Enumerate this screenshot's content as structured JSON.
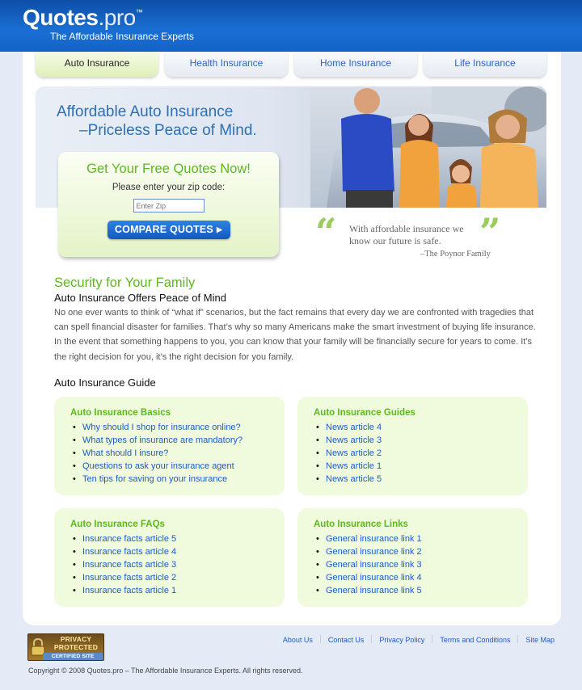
{
  "header": {
    "logo_main": "Quotes",
    "logo_pro": ".pro",
    "logo_tm": "™",
    "tagline": "The Affordable Insurance Experts"
  },
  "tabs": [
    {
      "label": "Auto Insurance",
      "active": true
    },
    {
      "label": "Health Insurance",
      "active": false
    },
    {
      "label": "Home Insurance",
      "active": false
    },
    {
      "label": "Life Insurance",
      "active": false
    }
  ],
  "hero": {
    "title_line1": "Affordable Auto Insurance",
    "title_line2": "–Priceless Peace of Mind."
  },
  "quote_box": {
    "title": "Get Your Free Quotes Now!",
    "prompt": "Please enter your zip code:",
    "zip_placeholder": "Enter Zip",
    "button_label": "COMPARE QUOTES"
  },
  "testimonial": {
    "text": "With affordable insurance we know our future is safe.",
    "author": "–The Poynor Family"
  },
  "content": {
    "section_title": "Security for Your Family",
    "section_subtitle": "Auto Insurance Offers Peace of Mind",
    "paragraph": "No one ever wants to think of “what if” scenarios, but the fact remains that every day we are confronted with tragedies that can spell financial disaster for families. That’s why so many Americans make the smart investment of buying life insurance. In the event that something happens to you, you can know that your family will be financially secure for years to come. It’s the right decision for you, it’s the right decision for you family.",
    "guide_title": "Auto Insurance Guide"
  },
  "guide_boxes": [
    {
      "title": "Auto Insurance Basics",
      "items": [
        "Why should I shop for insurance online?",
        "What types of insurance are mandatory?",
        "What should I insure?",
        "Questions to ask your insurance agent",
        "Ten tips for saving on your insurance"
      ]
    },
    {
      "title": "Auto Insurance Guides",
      "items": [
        "News article 4",
        "News article 3",
        "News article 2",
        "News article 1",
        "News article 5"
      ]
    },
    {
      "title": "Auto Insurance FAQs",
      "items": [
        "Insurance facts article 5",
        "Insurance facts article 4",
        "Insurance facts article 3",
        "Insurance facts article 2",
        "Insurance facts article 1"
      ]
    },
    {
      "title": "Auto Insurance Links",
      "items": [
        "General insurance link 1",
        "General insurance link 2",
        "General insurance link 3",
        "General insurance link 4",
        "General insurance link 5"
      ]
    }
  ],
  "footer": {
    "badge_line1": "PRIVACY",
    "badge_line2": "PROTECTED",
    "badge_sub": "CERTIFIED SITE",
    "links": [
      "About Us",
      "Contact Us",
      "Privacy Policy",
      "Terms and Conditions",
      "Site Map"
    ],
    "copyright": "Copyright © 2008 Quotes.pro – The Affordable Insurance Experts. All rights reserved."
  },
  "colors": {
    "brand_blue": "#1463c6",
    "accent_green": "#5db81d",
    "link_blue": "#1b5bc9"
  },
  "icons": [
    "padlock-icon",
    "open-quote-icon",
    "close-quote-icon",
    "play-arrow-icon"
  ]
}
